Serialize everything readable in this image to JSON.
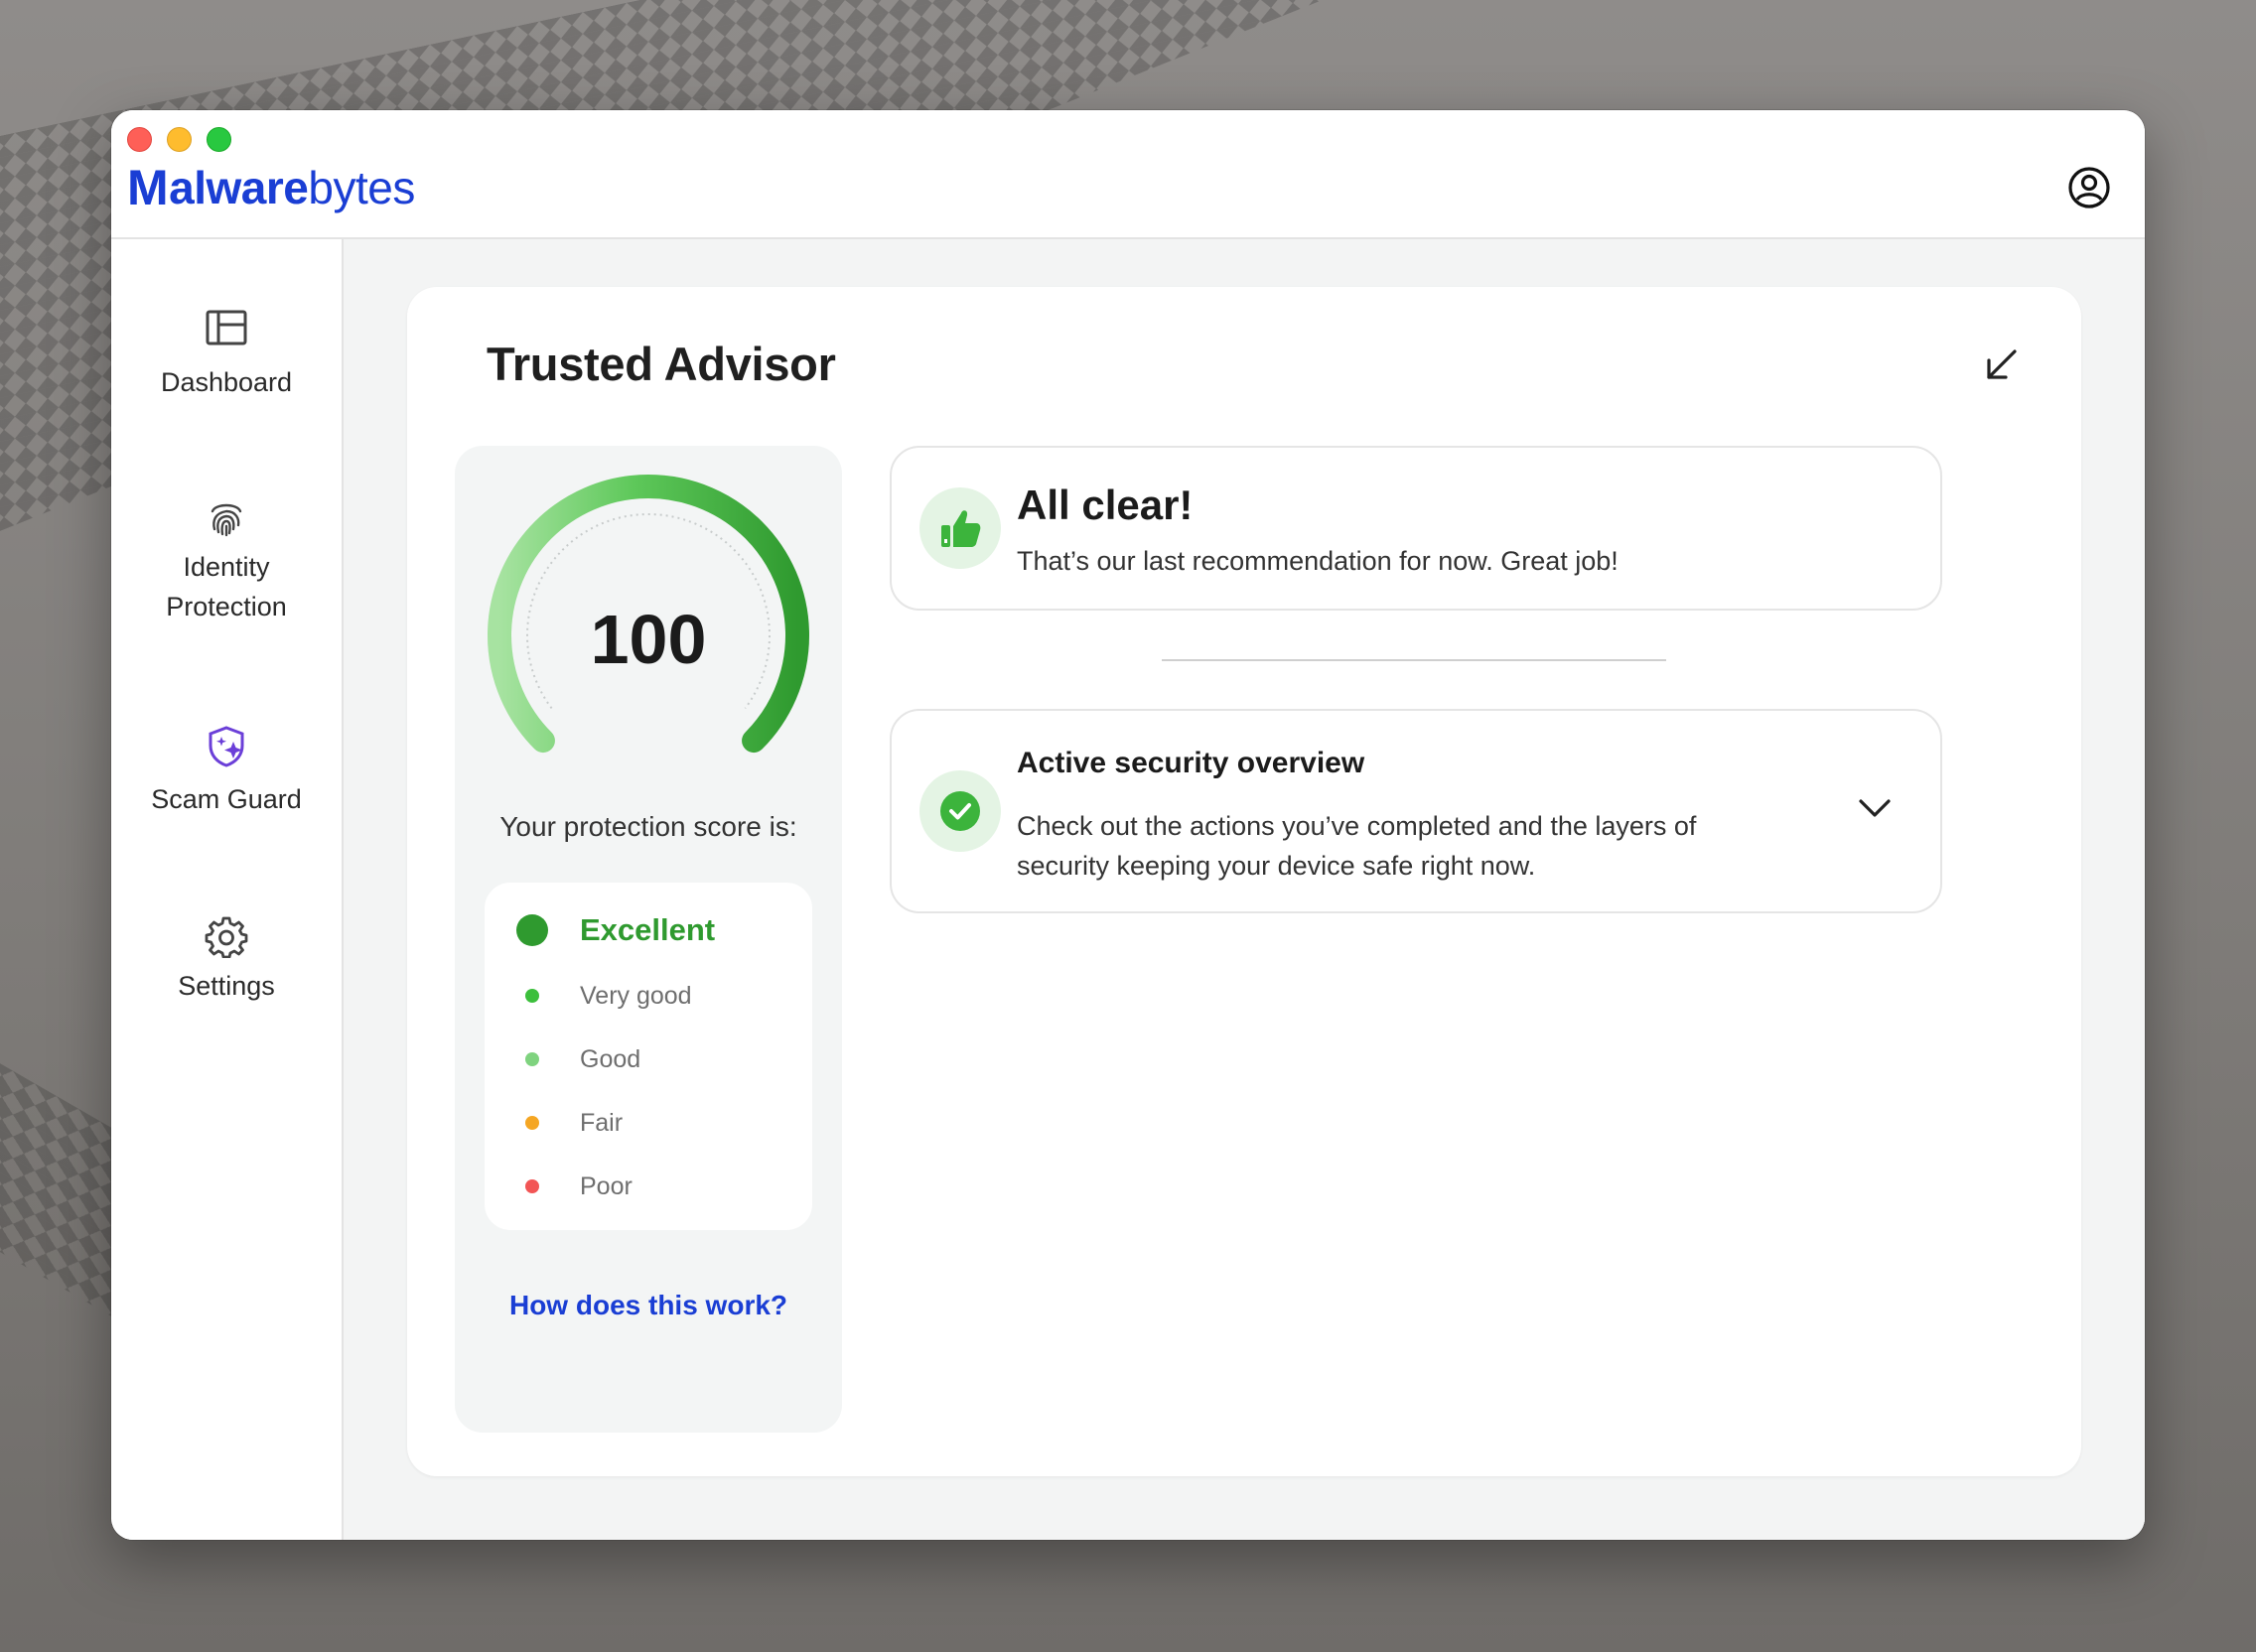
{
  "app": {
    "brand_bold": "M",
    "brand_mid": "alware",
    "brand_light": "bytes"
  },
  "sidebar": {
    "items": [
      {
        "label": "Dashboard",
        "icon": "dashboard-icon"
      },
      {
        "label": "Identity Protection",
        "icon": "fingerprint-icon"
      },
      {
        "label": "Scam Guard",
        "icon": "scam-guard-shield-icon"
      },
      {
        "label": "Settings",
        "icon": "gear-icon"
      }
    ]
  },
  "main": {
    "title": "Trusted Advisor",
    "score": {
      "value": "100",
      "label": "Your protection score is:",
      "fraction": 1.0,
      "levels": [
        {
          "label": "Excellent",
          "color": "#2f9a2f",
          "active": true
        },
        {
          "label": "Very good",
          "color": "#3cbf3c",
          "active": false
        },
        {
          "label": "Good",
          "color": "#7fd37f",
          "active": false
        },
        {
          "label": "Fair",
          "color": "#f5a623",
          "active": false
        },
        {
          "label": "Poor",
          "color": "#f25555",
          "active": false
        }
      ],
      "link": "How does this work?"
    },
    "all_clear": {
      "heading": "All clear!",
      "body": "That’s our last recommendation for now. Great job!",
      "icon": "thumbs-up-icon"
    },
    "overview": {
      "heading": "Active security overview",
      "body": "Check out the actions you’ve completed and the layers of security keeping your device safe right now.",
      "icon": "check-circle-icon"
    }
  },
  "colors": {
    "brand": "#1a3ed4",
    "accent_green": "#2f9a2f",
    "scam_guard_purple": "#6b3fd8"
  }
}
